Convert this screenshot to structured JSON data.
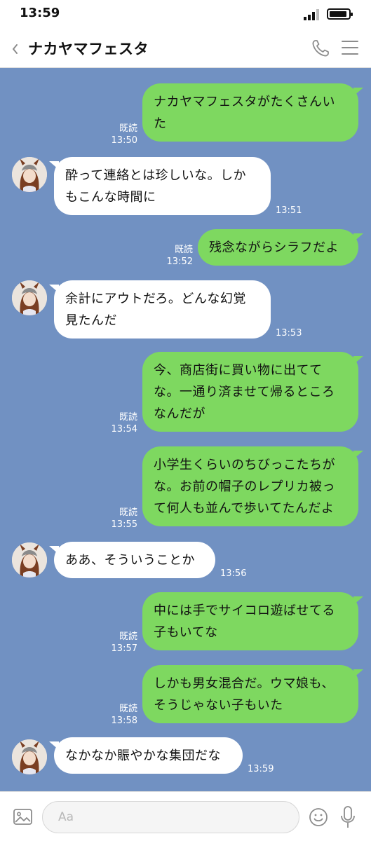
{
  "status_bar": {
    "time": "13:59"
  },
  "header": {
    "title": "ナカヤマフェスタ"
  },
  "messages": [
    {
      "side": "out",
      "text": "ナカヤマフェスタがたくさんい\nた",
      "read": "既読",
      "time": "13:50"
    },
    {
      "side": "in",
      "text": "酔って連絡とは珍しいな。しか\nもこんな時間に",
      "time": "13:51"
    },
    {
      "side": "out",
      "text": "残念ながらシラフだよ",
      "read": "既読",
      "time": "13:52"
    },
    {
      "side": "in",
      "text": "余計にアウトだろ。どんな幻覚\n見たんだ",
      "time": "13:53"
    },
    {
      "side": "out",
      "text": "今、商店街に買い物に出てて\nな。一通り済ませて帰るところ\nなんだが",
      "read": "既読",
      "time": "13:54"
    },
    {
      "side": "out",
      "text": "小学生くらいのちびっこたちが\nな。お前の帽子のレプリカ被っ\nて何人も並んで歩いてたんだよ",
      "read": "既読",
      "time": "13:55"
    },
    {
      "side": "in",
      "text": "ああ、そういうことか",
      "time": "13:56"
    },
    {
      "side": "out",
      "text": "中には手でサイコロ遊ばせてる\n子もいてな",
      "read": "既読",
      "time": "13:57"
    },
    {
      "side": "out",
      "text": "しかも男女混合だ。ウマ娘も、\nそうじゃない子もいた",
      "read": "既読",
      "time": "13:58"
    },
    {
      "side": "in",
      "text": "なかなか賑やかな集団だな",
      "time": "13:59"
    }
  ],
  "input_bar": {
    "placeholder": "Aa",
    "value": ""
  },
  "colors": {
    "chat_background": "#7191c2",
    "outgoing_bubble": "#7ed860",
    "incoming_bubble": "#ffffff"
  },
  "icons": {
    "back": "chevron-left-icon",
    "call": "phone-icon",
    "menu": "hamburger-menu-icon",
    "image": "image-icon",
    "emoji": "smiley-icon",
    "mic": "microphone-icon"
  }
}
